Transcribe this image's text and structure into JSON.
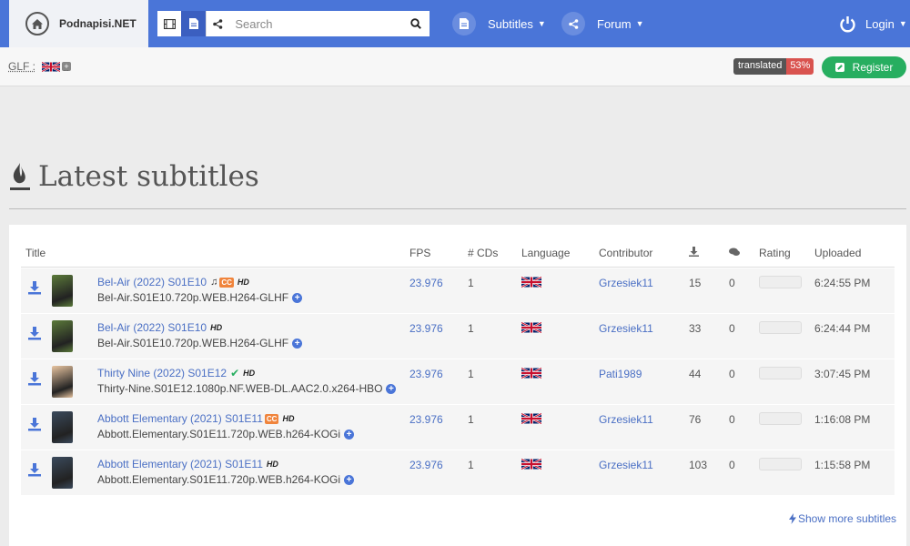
{
  "brand": {
    "name": "Podnapisi.NET"
  },
  "search": {
    "placeholder": "Search"
  },
  "nav": {
    "subtitles_label": "Subtitles",
    "forum_label": "Forum",
    "login_label": "Login"
  },
  "subbar": {
    "glf_label": "GLF :",
    "translated_label": "translated",
    "translated_pct": "53%",
    "register_label": "Register"
  },
  "page_title": "Latest subtitles",
  "table": {
    "headers": {
      "title": "Title",
      "fps": "FPS",
      "cds": "# CDs",
      "language": "Language",
      "contributor": "Contributor",
      "rating": "Rating",
      "uploaded": "Uploaded"
    },
    "rows": [
      {
        "title": "Bel-Air (2022) S01E10",
        "file": "Bel-Air.S01E10.720p.WEB.H264-GLHF",
        "badges": [
          "note",
          "cc",
          "hd"
        ],
        "fps": "23.976",
        "cds": "1",
        "language": "English",
        "contributor": "Grzesiek11",
        "downloads": "15",
        "comments": "0",
        "uploaded": "6:24:55 PM",
        "poster": "#5b7a3a"
      },
      {
        "title": "Bel-Air (2022) S01E10",
        "file": "Bel-Air.S01E10.720p.WEB.H264-GLHF",
        "badges": [
          "hd"
        ],
        "fps": "23.976",
        "cds": "1",
        "language": "English",
        "contributor": "Grzesiek11",
        "downloads": "33",
        "comments": "0",
        "uploaded": "6:24:44 PM",
        "poster": "#5b7a3a"
      },
      {
        "title": "Thirty Nine (2022) S01E12",
        "file": "Thirty-Nine.S01E12.1080p.NF.WEB-DL.AAC2.0.x264-HBO",
        "badges": [
          "check",
          "hd"
        ],
        "fps": "23.976",
        "cds": "1",
        "language": "English",
        "contributor": "Pati1989",
        "downloads": "44",
        "comments": "0",
        "uploaded": "3:07:45 PM",
        "poster": "#e8c4a0"
      },
      {
        "title": "Abbott Elementary (2021) S01E11",
        "file": "Abbott.Elementary.S01E11.720p.WEB.h264-KOGi",
        "badges": [
          "cc",
          "hd"
        ],
        "fps": "23.976",
        "cds": "1",
        "language": "English",
        "contributor": "Grzesiek11",
        "downloads": "76",
        "comments": "0",
        "uploaded": "1:16:08 PM",
        "poster": "#3b4a5c"
      },
      {
        "title": "Abbott Elementary (2021) S01E11",
        "file": "Abbott.Elementary.S01E11.720p.WEB.h264-KOGi",
        "badges": [
          "hd"
        ],
        "fps": "23.976",
        "cds": "1",
        "language": "English",
        "contributor": "Grzesiek11",
        "downloads": "103",
        "comments": "0",
        "uploaded": "1:15:58 PM",
        "poster": "#3b4a5c"
      }
    ]
  },
  "badge_text": {
    "cc": "CC",
    "hd": "HD"
  },
  "show_more": "Show more subtitles",
  "colors": {
    "nav": "#4a75d8",
    "link": "#4a6fc4",
    "register": "#27ae60",
    "cc": "#f0843c",
    "pct": "#d9534f"
  }
}
